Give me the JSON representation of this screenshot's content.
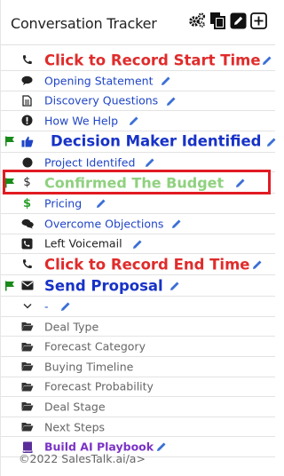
{
  "header": {
    "title": "Conversation Tracker",
    "icons": [
      "gears-icon",
      "copy-icon",
      "edit-square-icon",
      "plus-square-icon"
    ]
  },
  "colors": {
    "link_blue": "#1f45c6",
    "record_red": "#e02b2b",
    "highlight_navy": "#1732c7",
    "confirmed_green": "#8fd17f",
    "playbook_purple": "#7a33c5",
    "flag_green": "#1a8a1a",
    "highlight_border": "#e11b22"
  },
  "rows": [
    {
      "label": "Click to Record Start Time",
      "icon": "phone-icon",
      "flag": false
    },
    {
      "label": "Opening Statement",
      "icon": "comment-icon",
      "flag": false
    },
    {
      "label": "Discovery Questions",
      "icon": "document-icon",
      "flag": false
    },
    {
      "label": "How We Help",
      "icon": "exclamation-circle-icon",
      "flag": false
    },
    {
      "label": "Decision Maker Identified",
      "icon": "thumbs-up-icon",
      "flag": true
    },
    {
      "label": "Project Identifed",
      "icon": "circle-icon",
      "flag": false
    },
    {
      "label": "Confirmed The Budget",
      "icon": "dollar-icon",
      "flag": true,
      "highlighted": true
    },
    {
      "label": "Pricing",
      "icon": "dollar-icon",
      "flag": false
    },
    {
      "label": "Overcome Objections",
      "icon": "comments-icon",
      "flag": false
    },
    {
      "label": "Left Voicemail",
      "icon": "voicemail-icon",
      "flag": false
    },
    {
      "label": "Click to Record End Time",
      "icon": "phone-icon",
      "flag": false
    },
    {
      "label": "Send Proposal",
      "icon": "envelope-icon",
      "flag": true
    },
    {
      "label": "-",
      "icon": "chevron-down-icon",
      "flag": false
    },
    {
      "label": "Deal Type",
      "icon": "folder-open-icon",
      "flag": false
    },
    {
      "label": "Forecast Category",
      "icon": "folder-open-icon",
      "flag": false
    },
    {
      "label": "Buying Timeline",
      "icon": "folder-open-icon",
      "flag": false
    },
    {
      "label": "Forecast Probability",
      "icon": "folder-open-icon",
      "flag": false
    },
    {
      "label": "Deal Stage",
      "icon": "folder-open-icon",
      "flag": false
    },
    {
      "label": "Next Steps",
      "icon": "folder-open-icon",
      "flag": false
    },
    {
      "label": "Build AI Playbook",
      "icon": "book-icon",
      "flag": false
    }
  ],
  "footer": {
    "copyright": "©2022 SalesTalk.ai/a>"
  }
}
